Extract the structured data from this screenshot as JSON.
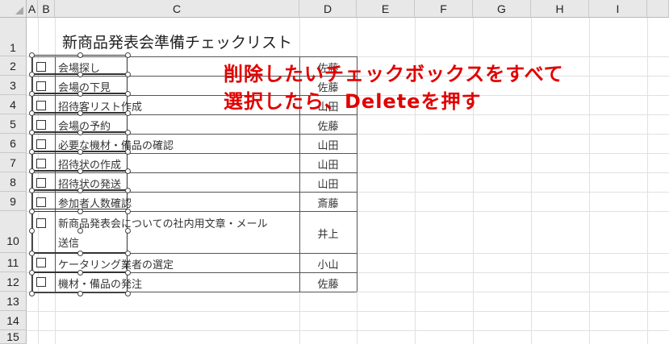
{
  "columns": [
    "A",
    "B",
    "C",
    "D",
    "E",
    "F",
    "G",
    "H",
    "I"
  ],
  "rows": [
    "1",
    "2",
    "3",
    "4",
    "5",
    "6",
    "7",
    "8",
    "9",
    "10",
    "11",
    "12",
    "13",
    "14",
    "15"
  ],
  "title": "新商品発表会準備チェックリスト",
  "tasks": [
    {
      "text": "会場探し",
      "person": "佐藤"
    },
    {
      "text": "会場の下見",
      "person": "佐藤"
    },
    {
      "text": "招待客リスト作成",
      "person": "山田"
    },
    {
      "text": "会場の予約",
      "person": "佐藤"
    },
    {
      "text": "必要な機材・備品の確認",
      "person": "山田"
    },
    {
      "text": "招待状の作成",
      "person": "山田"
    },
    {
      "text": "招待状の発送",
      "person": "山田"
    },
    {
      "text": "参加者人数確認",
      "person": "斎藤"
    },
    {
      "text": "新商品発表会についての社内用文章・メール",
      "text2": "送信",
      "person": "井上"
    },
    {
      "text": "ケータリング業者の選定",
      "person": "小山"
    },
    {
      "text": "機材・備品の発注",
      "person": "佐藤"
    }
  ],
  "callout": {
    "line1": "削除したいチェックボックスをすべて",
    "line2": "選択したら、Deleteを押す",
    "color": "#e00000"
  }
}
